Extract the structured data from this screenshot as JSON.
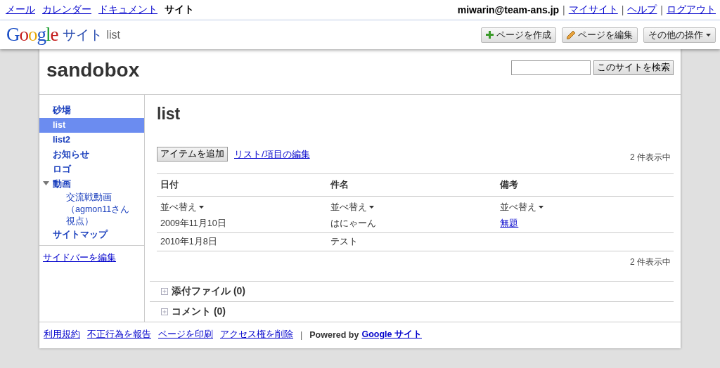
{
  "top_nav": {
    "links": [
      {
        "label": "メール",
        "selected": false
      },
      {
        "label": "カレンダー",
        "selected": false
      },
      {
        "label": "ドキュメント",
        "selected": false
      },
      {
        "label": "サイト",
        "selected": true
      }
    ],
    "user": "miwarin@team-ans.jp",
    "user_links": [
      "マイサイト",
      "ヘルプ",
      "ログアウト"
    ],
    "separator": "|"
  },
  "app_bar": {
    "logo": "Google",
    "product": "サイト",
    "page": "list",
    "buttons": [
      {
        "kind": "create",
        "label": "ページを作成"
      },
      {
        "kind": "edit",
        "label": "ページを編集"
      },
      {
        "kind": "menu",
        "label": "その他の操作"
      }
    ]
  },
  "site": {
    "title": "sandobox",
    "search_button": "このサイトを検索"
  },
  "sidebar": {
    "items": [
      {
        "label": "砂場",
        "selected": false
      },
      {
        "label": "list",
        "selected": true
      },
      {
        "label": "list2",
        "selected": false
      },
      {
        "label": "お知らせ",
        "selected": false
      },
      {
        "label": "ロゴ",
        "selected": false
      },
      {
        "label": "動画",
        "selected": false,
        "expanded": true,
        "children": [
          {
            "label": "交流戦動画（agmon11さん視点）",
            "selected": false
          }
        ]
      },
      {
        "label": "サイトマップ",
        "selected": false
      }
    ],
    "edit_link": "サイドバーを編集"
  },
  "page": {
    "title": "list",
    "add_button": "アイテムを追加",
    "edit_link": "リスト/項目の編集",
    "count_top": "2 件表示中",
    "count_bottom": "2 件表示中",
    "table": {
      "columns": [
        "日付",
        "件名",
        "備考"
      ],
      "sort_labels": [
        "並べ替え",
        "並べ替え",
        "並べ替え"
      ],
      "rows": [
        [
          {
            "text": "2009年11月10日",
            "link": false
          },
          {
            "text": "はにゃーん",
            "link": false
          },
          {
            "text": "無題",
            "link": true
          }
        ],
        [
          {
            "text": "2010年1月8日",
            "link": false
          },
          {
            "text": "テスト",
            "link": false
          }
        ]
      ]
    },
    "sections": [
      {
        "label": "添付ファイル (0)"
      },
      {
        "label": "コメント (0)"
      }
    ]
  },
  "footer": {
    "links": [
      "利用規約",
      "不正行為を報告",
      "ページを印刷",
      "アクセス権を削除"
    ],
    "separator": "|",
    "powered": "Powered by",
    "powered_link": "Google サイト"
  }
}
